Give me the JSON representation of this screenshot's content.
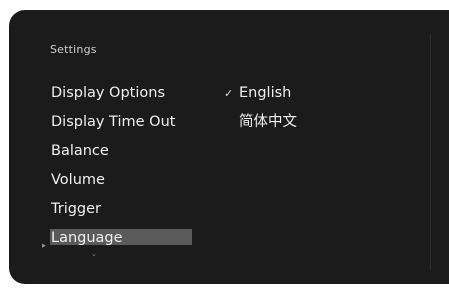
{
  "screen": {
    "title": "Settings"
  },
  "menu": {
    "items": [
      {
        "label": "Display Options"
      },
      {
        "label": "Display Time Out"
      },
      {
        "label": "Balance"
      },
      {
        "label": "Volume"
      },
      {
        "label": "Trigger"
      },
      {
        "label": "Language"
      }
    ],
    "selected": "Language"
  },
  "options": {
    "items": [
      {
        "label": "English",
        "checked": true
      },
      {
        "label": "简体中文",
        "checked": false
      }
    ]
  },
  "icons": {
    "check": "check-icon",
    "pointer": "pointer-icon",
    "scroll": "chevron-down-icon"
  },
  "colors": {
    "background": "#1b1b1b",
    "highlight": "#5a5a5a",
    "text": "#f0f0f0"
  }
}
